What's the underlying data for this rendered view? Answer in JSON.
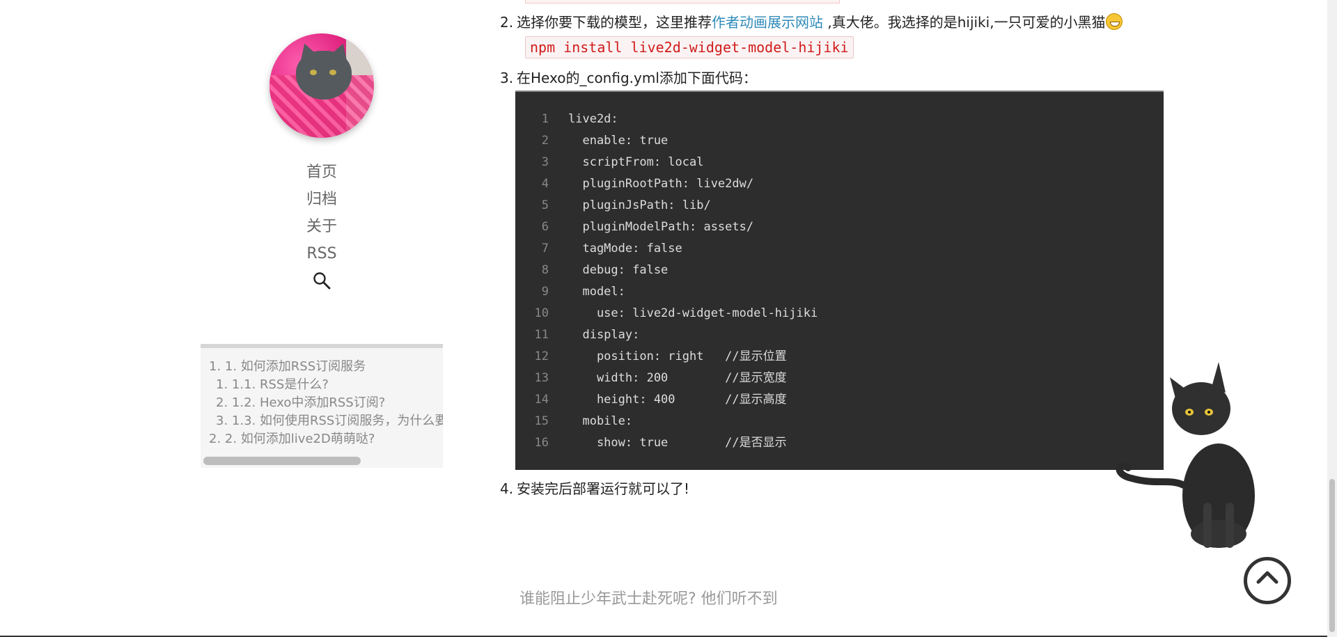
{
  "sidebar": {
    "nav": [
      "首页",
      "归档",
      "关于",
      "RSS"
    ],
    "toc": [
      {
        "label": "1. 1. 如何添加RSS订阅服务",
        "level": 1
      },
      {
        "label": "1. 1.1. RSS是什么?",
        "level": 2
      },
      {
        "label": "2. 1.2. Hexo中添加RSS订阅?",
        "level": 2
      },
      {
        "label": "3. 1.3. 如何使用RSS订阅服务，为什么要",
        "level": 2
      },
      {
        "label": "2. 2. 如何添加live2D萌萌哒?",
        "level": 1
      }
    ]
  },
  "content": {
    "item2": {
      "num": "2.",
      "before": "选择你要下载的模型，这里推荐",
      "link": "作者动画展示网站",
      "after": " ,真大佬。我选择的是hijiki,一只可爱的小黑猫"
    },
    "npm_command": "npm install live2d-widget-model-hijiki",
    "item3": {
      "num": "3.",
      "text": "在Hexo的_config.yml添加下面代码："
    },
    "code_lines": [
      "live2d:",
      "  enable: true",
      "  scriptFrom: local",
      "  pluginRootPath: live2dw/",
      "  pluginJsPath: lib/",
      "  pluginModelPath: assets/",
      "  tagMode: false",
      "  debug: false",
      "  model:",
      "    use: live2d-widget-model-hijiki",
      "  display:",
      "    position: right   //显示位置",
      "    width: 200        //显示宽度",
      "    height: 400       //显示高度",
      "  mobile:",
      "    show: true        //是否显示"
    ],
    "item4": {
      "num": "4.",
      "text": "安装完后部署运行就可以了!"
    }
  },
  "footer": {
    "text": "谁能阻止少年武士赴死呢? 他们听不到"
  },
  "icons": {
    "search": "search-icon",
    "back_to_top": "chevron-up-icon",
    "emoji": "grinning-face-icon"
  }
}
